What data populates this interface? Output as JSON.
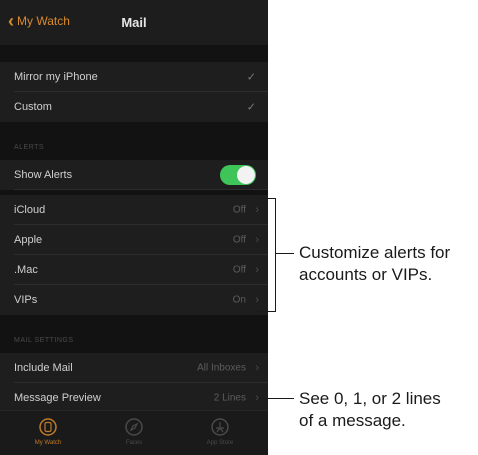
{
  "navbar": {
    "back_label": "My Watch",
    "title": "Mail"
  },
  "mirror_section": {
    "mirror_label": "Mirror my iPhone",
    "custom_label": "Custom"
  },
  "alerts_section": {
    "header": "ALERTS",
    "show_alerts_label": "Show Alerts",
    "show_alerts_on": true,
    "accounts": [
      {
        "label": "iCloud",
        "value": "Off"
      },
      {
        "label": "Apple",
        "value": "Off"
      },
      {
        "label": ".Mac",
        "value": "Off"
      },
      {
        "label": "VIPs",
        "value": "On"
      }
    ]
  },
  "mail_settings": {
    "header": "MAIL SETTINGS",
    "include_mail_label": "Include Mail",
    "include_mail_value": "All Inboxes",
    "message_preview_label": "Message Preview",
    "message_preview_value": "2 Lines"
  },
  "tabbar": {
    "tabs": [
      {
        "label": "My Watch",
        "icon": "watch-icon",
        "active": true
      },
      {
        "label": "Faces",
        "icon": "compass-icon",
        "active": false
      },
      {
        "label": "App Store",
        "icon": "app-store-icon",
        "active": false
      }
    ]
  },
  "callouts": {
    "accounts_line1": "Customize alerts for",
    "accounts_line2": "accounts or VIPs.",
    "preview_line1": "See 0, 1, or 2 lines",
    "preview_line2": "of a message."
  },
  "colors": {
    "accent": "#d98a2b",
    "toggle_on": "#3fc45a",
    "background": "#121212"
  }
}
